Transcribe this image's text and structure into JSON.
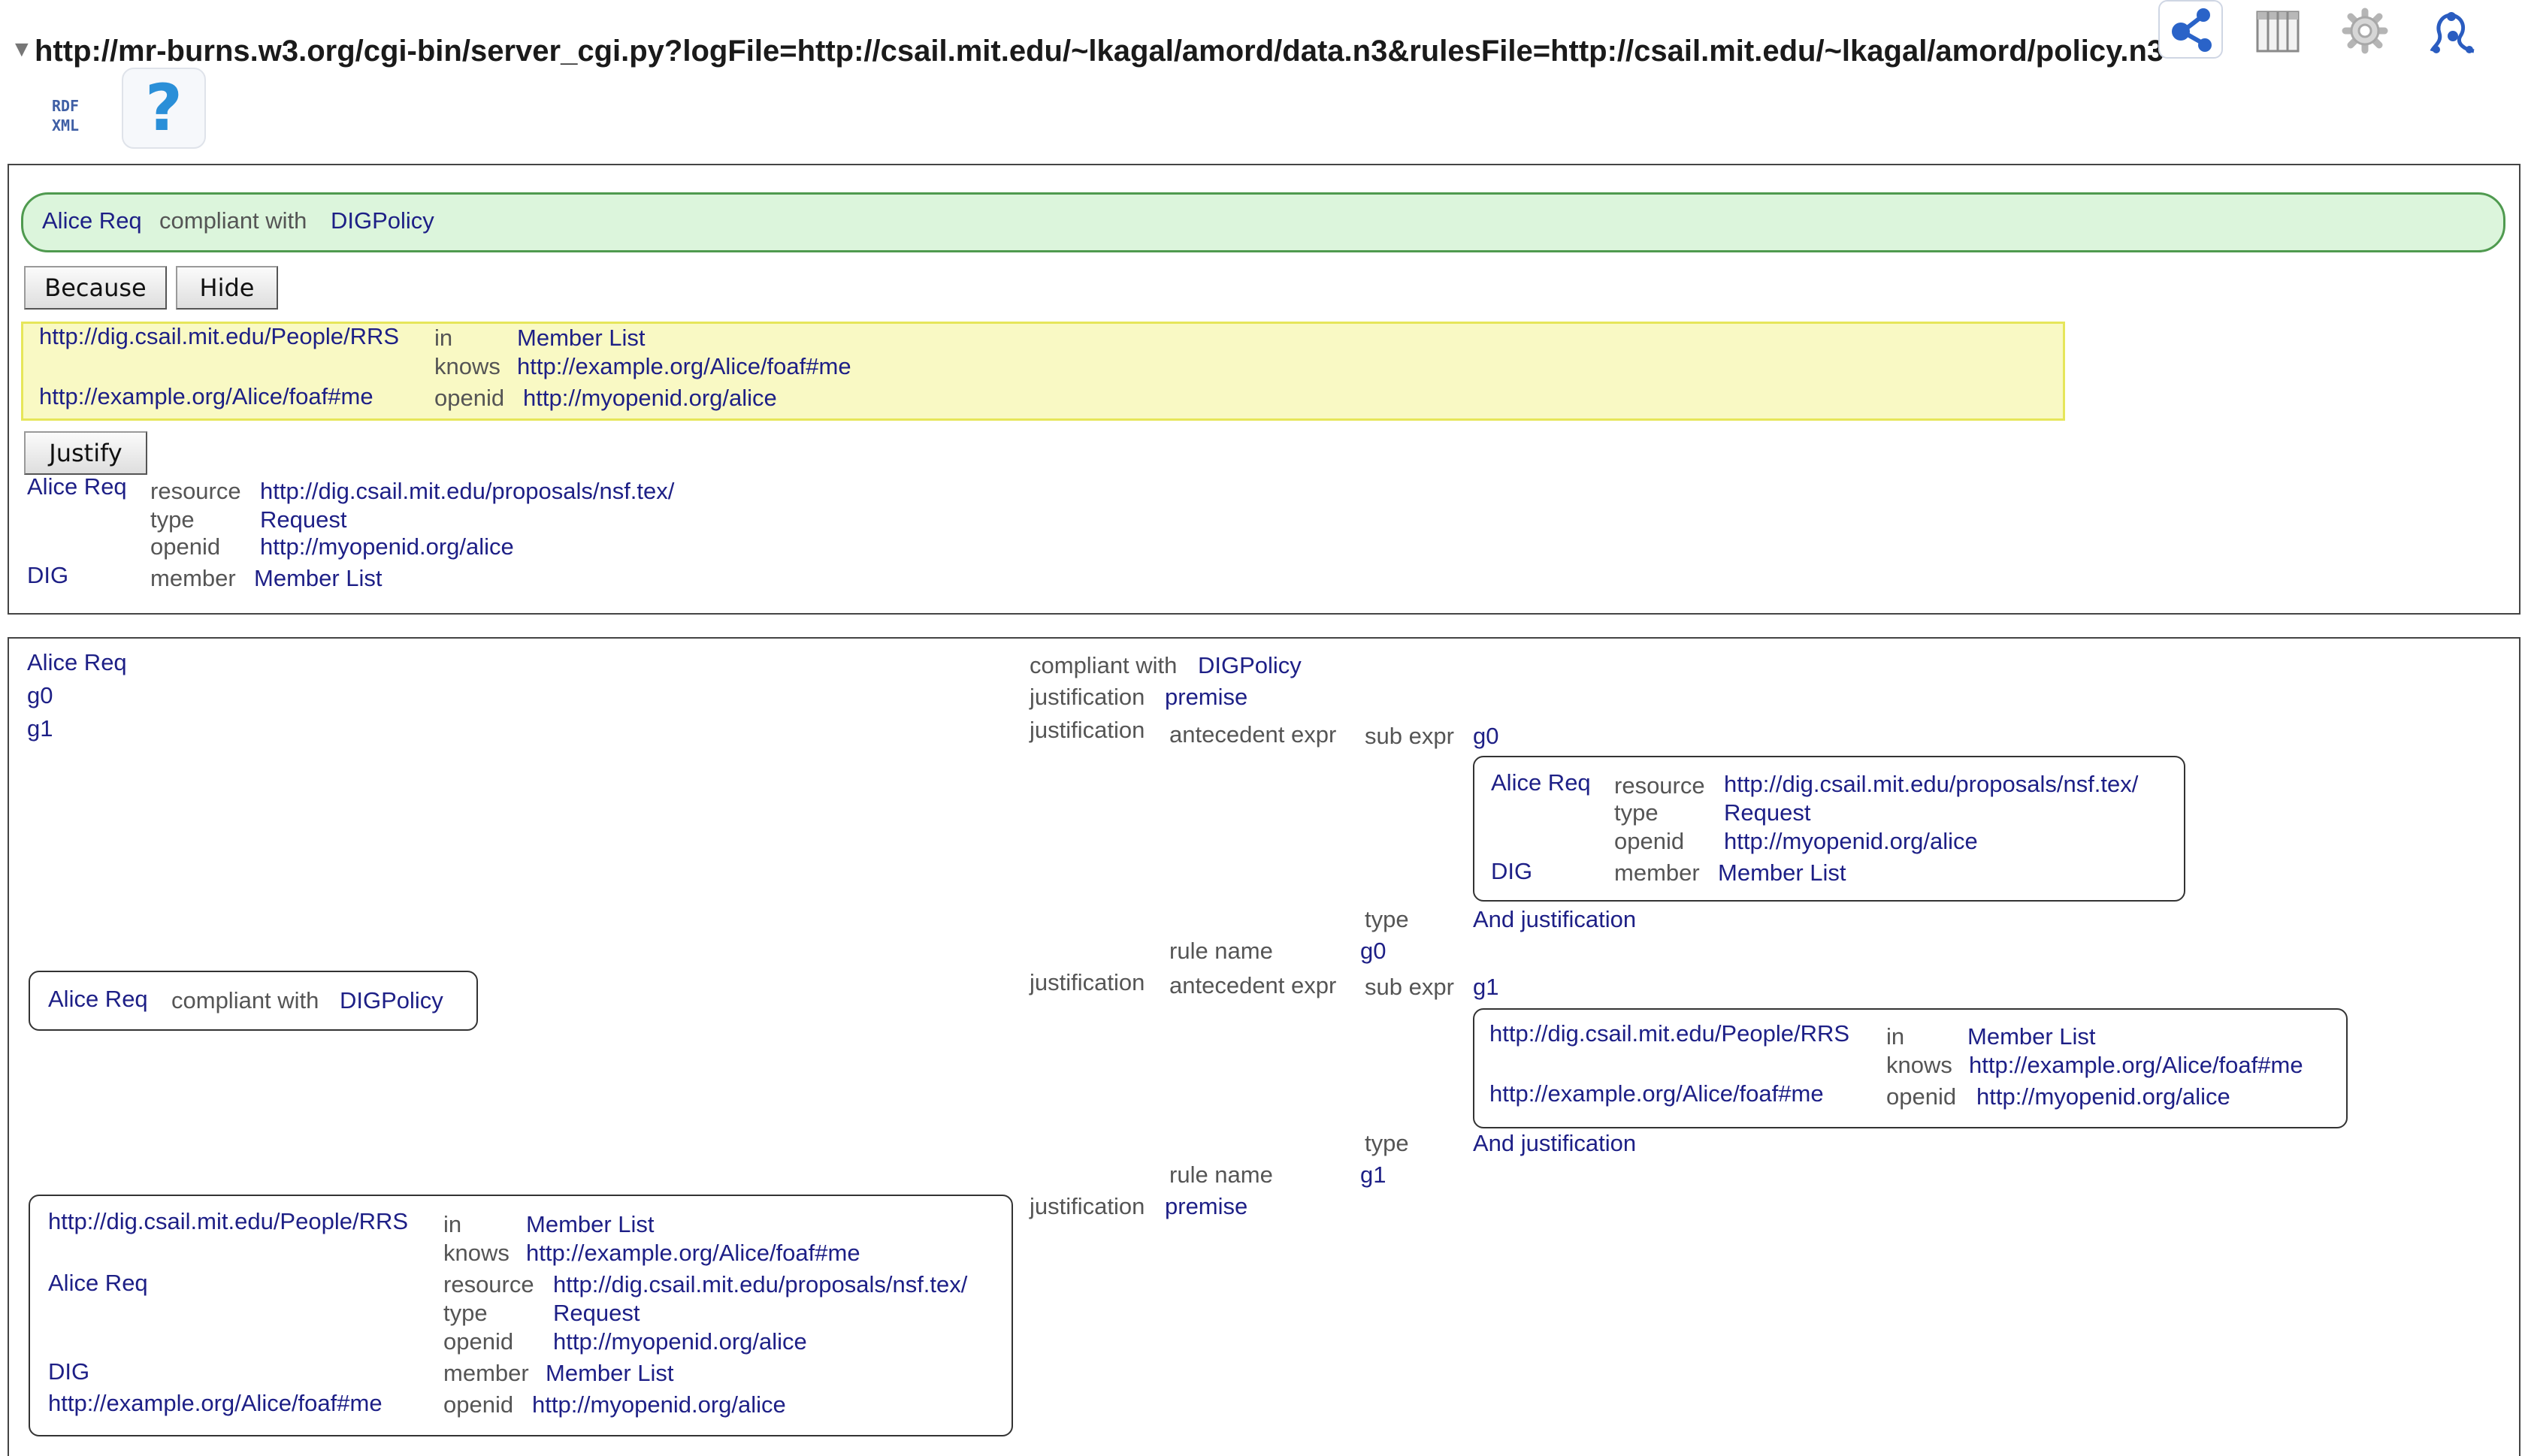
{
  "header": {
    "triangle": "▼",
    "url": "http://mr-burns.w3.org/cgi-bin/server_cgi.py?logFile=http://csail.mit.edu/~lkagal/amord/data.n3&rulesFile=http://csail.mit.edu/~lkagal/amord/policy.n3",
    "rdf_line1": "RDF",
    "rdf_line2": "XML",
    "help_glyph": "?",
    "icons": [
      "graph-view-icon",
      "table-view-icon",
      "settings-gear-icon",
      "justification-icon"
    ]
  },
  "summary": {
    "subject": "Alice Req",
    "predicate": "compliant with",
    "object": "DIGPolicy",
    "because_label": "Because",
    "hide_label": "Hide",
    "because_facts": {
      "s1": "http://dig.csail.mit.edu/People/RRS",
      "p1": "in",
      "o1": "Member List",
      "p2": "knows",
      "o2": "http://example.org/Alice/foaf#me",
      "s3": "http://example.org/Alice/foaf#me",
      "p3": "openid",
      "o3": "http://myopenid.org/alice"
    },
    "justify_label": "Justify",
    "justify_facts": {
      "s1": "Alice Req",
      "p1": "resource",
      "o1": "http://dig.csail.mit.edu/proposals/nsf.tex/",
      "p2": "type",
      "o2": "Request",
      "p3": "openid",
      "o3": "http://myopenid.org/alice",
      "s4": "DIG",
      "p4": "member",
      "o4": "Member List"
    }
  },
  "detail": {
    "subjects": [
      "Alice Req",
      "g0",
      "g1"
    ],
    "r1_pred": "compliant with",
    "r1_obj": "DIGPolicy",
    "r2_pred": "justification",
    "r2_obj": "premise",
    "r3_pred": "justification",
    "antecedent_expr": "antecedent expr",
    "sub_expr": "sub expr",
    "g0": "g0",
    "g1": "g1",
    "g0_box": {
      "s1": "Alice Req",
      "p1": "resource",
      "o1": "http://dig.csail.mit.edu/proposals/nsf.tex/",
      "p2": "type",
      "o2": "Request",
      "p3": "openid",
      "o3": "http://myopenid.org/alice",
      "s4": "DIG",
      "p4": "member",
      "o4": "Member List"
    },
    "type_label": "type",
    "and_justification": "And justification",
    "rule_name_label": "rule name",
    "justification_label": "justification",
    "premise": "premise",
    "g1_box": {
      "s1": "http://dig.csail.mit.edu/People/RRS",
      "p1": "in",
      "o1": "Member List",
      "p2": "knows",
      "o2": "http://example.org/Alice/foaf#me",
      "s3": "http://example.org/Alice/foaf#me",
      "p3": "openid",
      "o3": "http://myopenid.org/alice"
    },
    "mid_box": {
      "subject": "Alice Req",
      "predicate": "compliant with",
      "object": "DIGPolicy"
    },
    "bottom_box": {
      "s1": "http://dig.csail.mit.edu/People/RRS",
      "p1": "in",
      "o1": "Member List",
      "p2": "knows",
      "o2": "http://example.org/Alice/foaf#me",
      "s3": "Alice Req",
      "p3": "resource",
      "o3": "http://dig.csail.mit.edu/proposals/nsf.tex/",
      "p4": "type",
      "o4": "Request",
      "p5": "openid",
      "o5": "http://myopenid.org/alice",
      "s6": "DIG",
      "p6": "member",
      "o6": "Member List",
      "s7": "http://example.org/Alice/foaf#me",
      "p7": "openid",
      "o7": "http://myopenid.org/alice"
    }
  }
}
